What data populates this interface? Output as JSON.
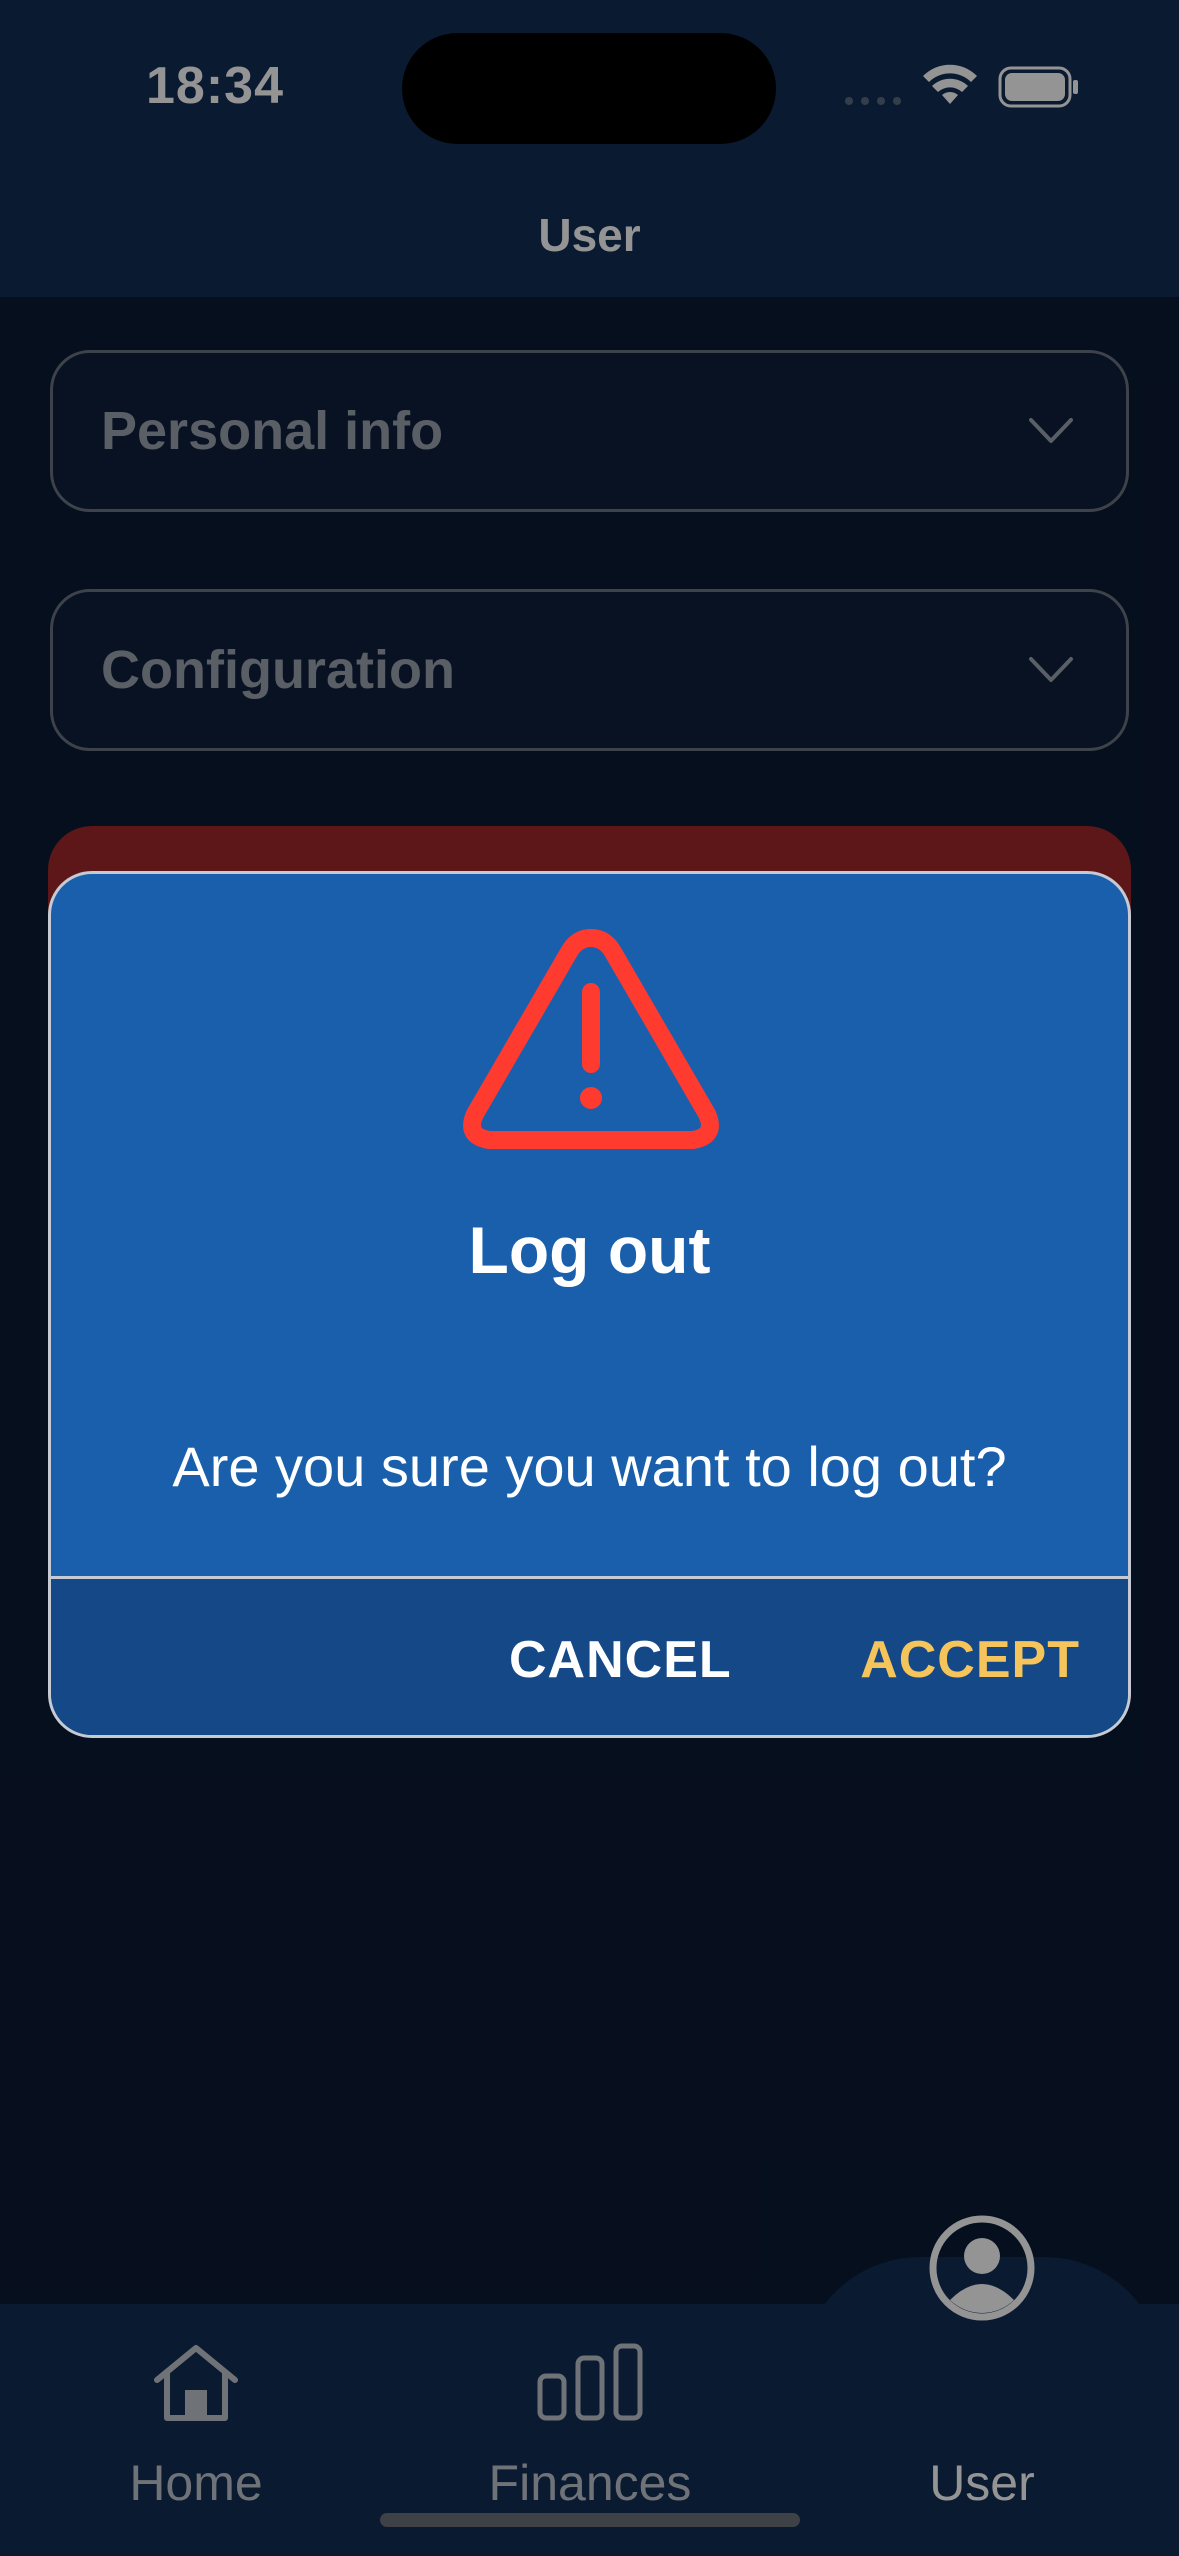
{
  "status_bar": {
    "time": "18:34"
  },
  "header": {
    "title": "User"
  },
  "sections": [
    {
      "label": "Personal info"
    },
    {
      "label": "Configuration"
    }
  ],
  "dialog": {
    "icon": "warning-triangle-icon",
    "title": "Log out",
    "message": "Are you sure you want to log out?",
    "cancel_label": "CANCEL",
    "accept_label": "ACCEPT",
    "accent_color": "#f5c45a",
    "warning_color": "#ff3b30"
  },
  "tabbar": {
    "items": [
      {
        "label": "Home",
        "icon": "home-icon"
      },
      {
        "label": "Finances",
        "icon": "bar-chart-icon"
      },
      {
        "label": "User",
        "icon": "user-circle-icon",
        "active": true
      }
    ]
  }
}
